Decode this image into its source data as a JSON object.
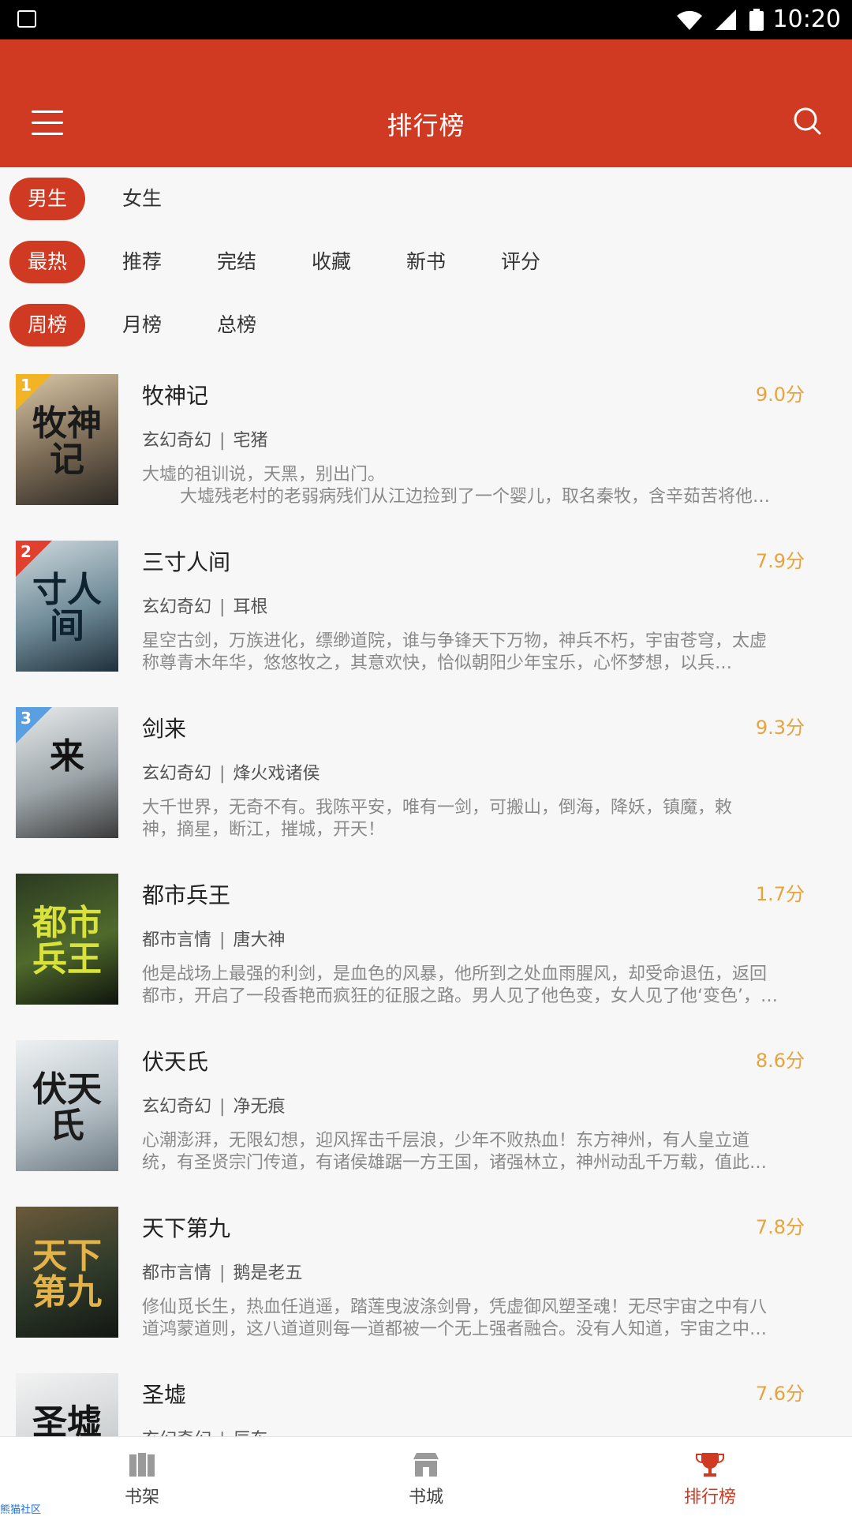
{
  "status": {
    "time": "10:20"
  },
  "appbar": {
    "title": "排行榜"
  },
  "filters": {
    "gender": [
      {
        "label": "男生",
        "active": true
      },
      {
        "label": "女生",
        "active": false
      }
    ],
    "category": [
      {
        "label": "最热",
        "active": true
      },
      {
        "label": "推荐",
        "active": false
      },
      {
        "label": "完结",
        "active": false
      },
      {
        "label": "收藏",
        "active": false
      },
      {
        "label": "新书",
        "active": false
      },
      {
        "label": "评分",
        "active": false
      }
    ],
    "period": [
      {
        "label": "周榜",
        "active": true
      },
      {
        "label": "月榜",
        "active": false
      },
      {
        "label": "总榜",
        "active": false
      }
    ]
  },
  "books": [
    {
      "rank": "1",
      "badge_color": "#f2b424",
      "title": "牧神记",
      "score": "9.0分",
      "genre": "玄幻奇幻",
      "author": "宅猪",
      "cover_text": "牧神记",
      "cover_colors": [
        "#d9c7a6",
        "#7a6a55",
        "#2c2924"
      ],
      "cover_text_color": "#1a1a1a",
      "desc": [
        "大墟的祖训说，天黑，别出门。",
        "大墟残老村的老弱病残们从江边捡到了一个婴儿，取名秦牧，含辛茹苦将他…"
      ],
      "desc_indent_second": true
    },
    {
      "rank": "2",
      "badge_color": "#e2402e",
      "title": "三寸人间",
      "score": "7.9分",
      "genre": "玄幻奇幻",
      "author": "耳根",
      "cover_text": "寸人间",
      "cover_colors": [
        "#cfd9de",
        "#6f8b98",
        "#1f2f3a"
      ],
      "cover_text_color": "#0e2230",
      "desc": [
        "星空古剑，万族进化，缥缈道院，谁与争锋天下万物，神兵不朽，宇宙苍穹，太虚",
        "称尊青木年华，悠悠牧之，其意欢快，恰似朝阳少年宝乐，心怀梦想，以兵…"
      ],
      "desc_indent_second": false
    },
    {
      "rank": "3",
      "badge_color": "#5aa0e0",
      "title": "剑来",
      "score": "9.3分",
      "genre": "玄幻奇幻",
      "author": "烽火戏诸侯",
      "cover_text": "来",
      "cover_colors": [
        "#e8ebec",
        "#9ba4a8",
        "#3b3a3a"
      ],
      "cover_text_color": "#111111",
      "desc": [
        "大千世界，无奇不有。我陈平安，唯有一剑，可搬山，倒海，降妖，镇魔，敕",
        "神，摘星，断江，摧城，开天！"
      ],
      "desc_indent_second": false
    },
    {
      "rank": "",
      "badge_color": "",
      "title": "都市兵王",
      "score": "1.7分",
      "genre": "都市言情",
      "author": "唐大神",
      "cover_text": "都市兵王",
      "cover_colors": [
        "#2b3a22",
        "#4f6a2c",
        "#0f140c"
      ],
      "cover_text_color": "#d8e23a",
      "desc": [
        "他是战场上最强的利剑，是血色的风暴，他所到之处血雨腥风，却受命退伍，返回",
        "都市，开启了一段香艳而疯狂的征服之路。男人见了他色变，女人见了他‘变色’，…"
      ],
      "desc_indent_second": false
    },
    {
      "rank": "",
      "badge_color": "",
      "title": "伏天氏",
      "score": "8.6分",
      "genre": "玄幻奇幻",
      "author": "净无痕",
      "cover_text": "伏天氏",
      "cover_colors": [
        "#eef1f3",
        "#b7c2c8",
        "#6d7a82"
      ],
      "cover_text_color": "#1b1b1b",
      "desc": [
        "心潮澎湃，无限幻想，迎风挥击千层浪，少年不败热血！东方神州，有人皇立道",
        "统，有圣贤宗门传道，有诸侯雄踞一方王国，诸强林立，神州动乱千万载，值此…"
      ],
      "desc_indent_second": false
    },
    {
      "rank": "",
      "badge_color": "",
      "title": "天下第九",
      "score": "7.8分",
      "genre": "都市言情",
      "author": "鹅是老五",
      "cover_text": "天下第九",
      "cover_colors": [
        "#6b5a3a",
        "#2f3a2a",
        "#121712"
      ],
      "cover_text_color": "#e3b34a",
      "desc": [
        "修仙觅长生，热血任逍遥，踏莲曳波涤剑骨，凭虚御风塑圣魂！无尽宇宙之中有八",
        "道鸿蒙道则，这八道道则每一道都被一个无上强者融合。没有人知道，宇宙之中…"
      ],
      "desc_indent_second": false
    },
    {
      "rank": "",
      "badge_color": "",
      "title": "圣墟",
      "score": "7.6分",
      "genre": "玄幻奇幻",
      "author": "辰东",
      "cover_text": "圣墟",
      "cover_colors": [
        "#f3f3f3",
        "#cfd2d4",
        "#8c9296"
      ],
      "cover_text_color": "#151515",
      "desc": [
        "",
        ""
      ],
      "desc_indent_second": false
    }
  ],
  "bottom_nav": [
    {
      "label": "书架",
      "icon": "bookshelf-icon",
      "active": false
    },
    {
      "label": "书城",
      "icon": "store-icon",
      "active": false
    },
    {
      "label": "排行榜",
      "icon": "trophy-icon",
      "active": true
    }
  ],
  "watermark": "熊猫社区",
  "colors": {
    "primary": "#d13a22",
    "score": "#e8a33b"
  }
}
